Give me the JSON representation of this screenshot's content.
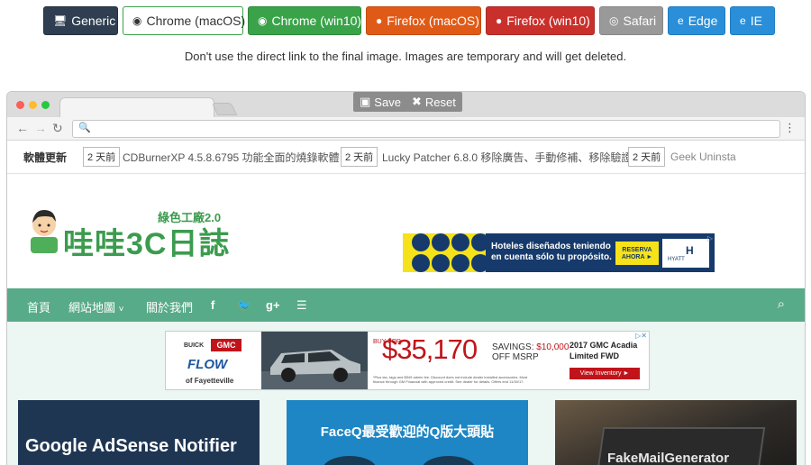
{
  "browser_buttons": [
    {
      "label": "Generic",
      "icon": "monitor-icon",
      "color": "#2f3e50"
    },
    {
      "label": "Chrome (macOS)",
      "icon": "chrome-icon",
      "color": "#ffffff"
    },
    {
      "label": "Chrome (win10)",
      "icon": "chrome-icon",
      "color": "#3aa34a"
    },
    {
      "label": "Firefox (macOS)",
      "icon": "firefox-icon",
      "color": "#e05a17"
    },
    {
      "label": "Firefox (win10)",
      "icon": "firefox-icon",
      "color": "#c9302c"
    },
    {
      "label": "Safari",
      "icon": "safari-icon",
      "color": "#999999"
    },
    {
      "label": "Edge",
      "icon": "edge-icon",
      "color": "#2a8fd8"
    },
    {
      "label": "IE",
      "icon": "ie-icon",
      "color": "#2a8fd8"
    }
  ],
  "notice": "Don't use the direct link to the final image. Images are temporary and will get deleted.",
  "window": {
    "save_label": "Save",
    "reset_label": "Reset",
    "url_value": ""
  },
  "site": {
    "ticker": {
      "label": "軟體更新",
      "items": [
        {
          "badge": "2 天前",
          "text": "CDBurnerXP 4.5.8.6795 功能全面的燒錄軟體"
        },
        {
          "badge": "2 天前",
          "text": "Lucky Patcher 6.8.0 移除廣告、手動修補、移除驗證"
        },
        {
          "badge": "2 天前",
          "text": "Geek Uninsta"
        }
      ]
    },
    "logo": {
      "sub": "綠色工廠2.0",
      "main": "哇哇3C日誌"
    },
    "ad_hotel": {
      "text_line1": "Hoteles diseñados teniendo",
      "text_line2": "en cuenta sólo tu propósito.",
      "cta_line1": "RESERVA",
      "cta_line2": "AHORA ►",
      "brand": "HYATT"
    },
    "nav": {
      "items": [
        "首頁",
        "網站地圖",
        "關於我們"
      ],
      "social_icons": [
        "facebook-icon",
        "twitter-icon",
        "google-plus-icon",
        "rss-icon"
      ]
    },
    "ad_car": {
      "brand1": "BUICK",
      "brand2": "GMC",
      "dealer_logo": "FLOW",
      "dealer": "of Fayetteville",
      "buy_for": "BUY FOR",
      "price": "$35,170",
      "savings_label": "SAVINGS:",
      "savings_value": "$10,000",
      "savings_suffix": "OFF MSRP",
      "model_line1": "2017 GMC Acadia",
      "model_line2": "Limited FWD",
      "cta": "View Inventory ►",
      "fine_print_1": "*Plus tax, tags and $549 admin fee. Discount does not include dealer installed accessories. Must",
      "fine_print_2": "finance through GM Financial with approved credit. See dealer for details. Offers end 11/30/17."
    },
    "cards": [
      {
        "title": "Google AdSense Notifier"
      },
      {
        "title": "FaceQ最受歡迎的Q版大頭貼"
      },
      {
        "title": "FakeMailGenerator"
      }
    ]
  }
}
